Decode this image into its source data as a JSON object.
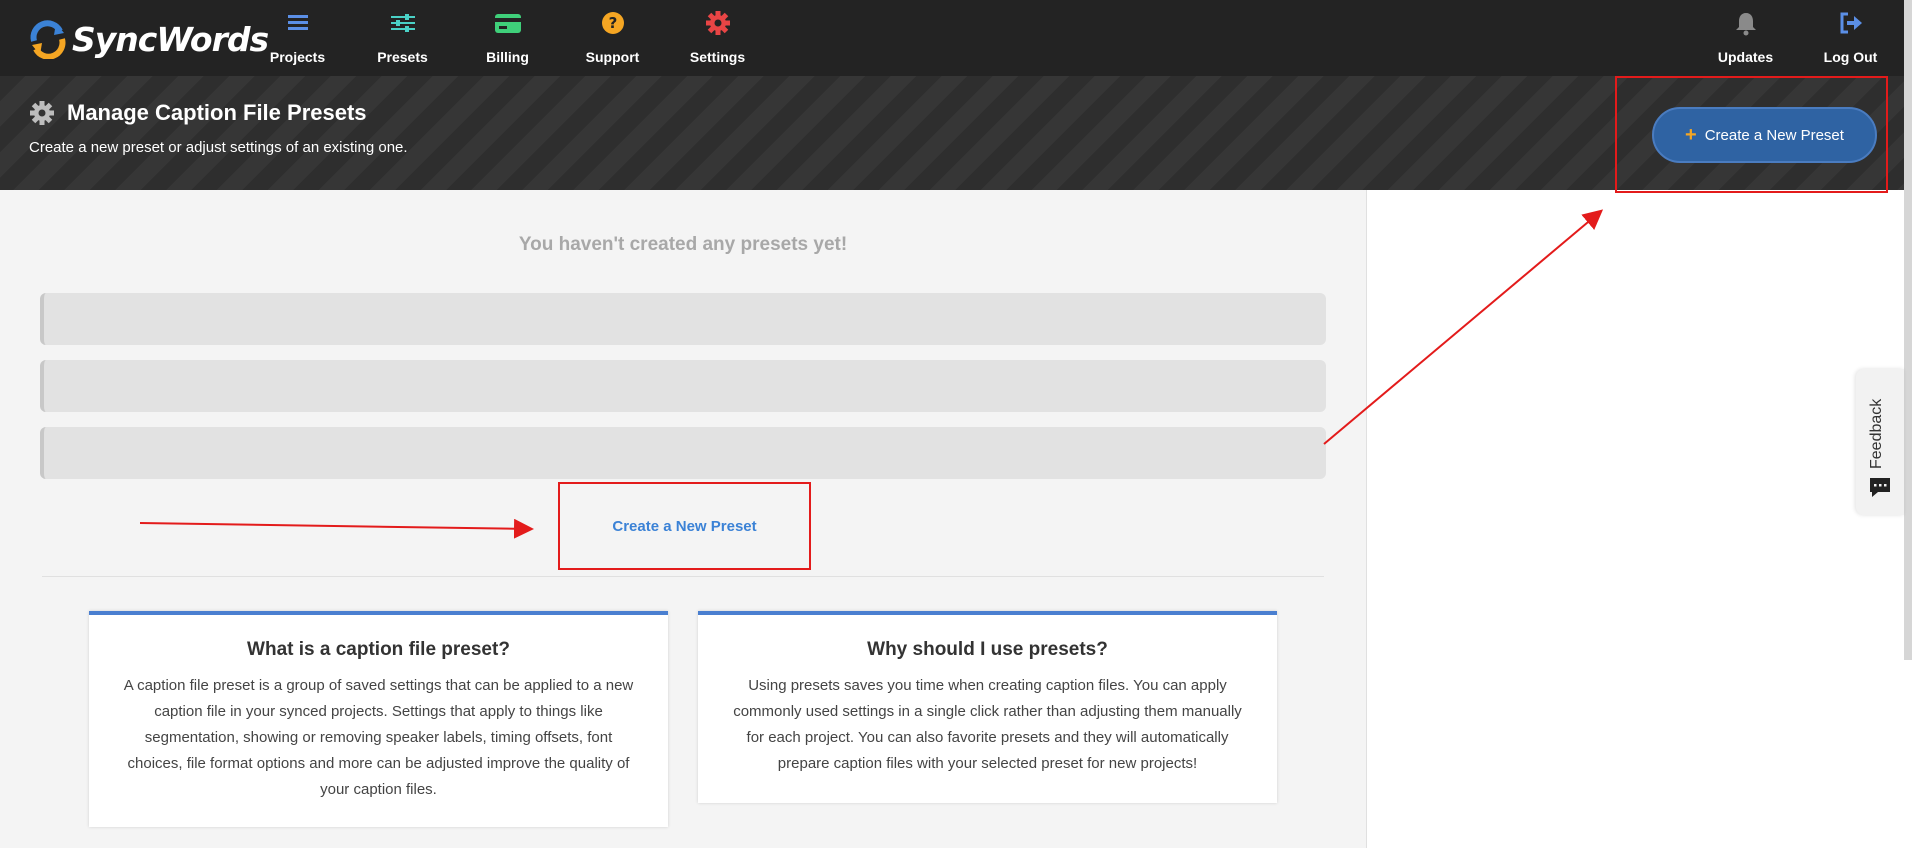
{
  "app": {
    "logo_text": "SyncWords"
  },
  "nav": {
    "items": [
      {
        "label": "Projects",
        "icon": "list-icon"
      },
      {
        "label": "Presets",
        "icon": "sliders-icon"
      },
      {
        "label": "Billing",
        "icon": "card-icon"
      },
      {
        "label": "Support",
        "icon": "help-icon"
      },
      {
        "label": "Settings",
        "icon": "gear-icon"
      }
    ],
    "right": [
      {
        "label": "Updates",
        "icon": "bell-icon"
      },
      {
        "label": "Log Out",
        "icon": "logout-icon"
      }
    ]
  },
  "header": {
    "title": "Manage Caption File Presets",
    "subtitle": "Create a new preset or adjust settings of an existing one.",
    "button_label": "Create a New Preset"
  },
  "main": {
    "empty_message": "You haven't created any presets yet!",
    "create_link": "Create a New Preset"
  },
  "cards": [
    {
      "title": "What is a caption file preset?",
      "body": "A caption file preset is a group of saved settings that can be applied to a new caption file in your synced projects. Settings that apply to things like segmentation, showing or removing speaker labels, timing offsets, font choices, file format options and more can be adjusted improve the quality of your caption files."
    },
    {
      "title": "Why should I use presets?",
      "body": "Using presets saves you time when creating caption files. You can apply commonly used settings in a single click rather than adjusting them manually for each project. You can also favorite presets and they will automatically prepare caption files with your selected preset for new projects!"
    }
  ],
  "feedback": {
    "label": "Feedback"
  },
  "colors": {
    "nav_bg": "#232323",
    "accent_blue": "#2f63a3",
    "link_blue": "#3b82d6",
    "annotation_red": "#e31b1b",
    "plus_orange": "#f5a623"
  }
}
